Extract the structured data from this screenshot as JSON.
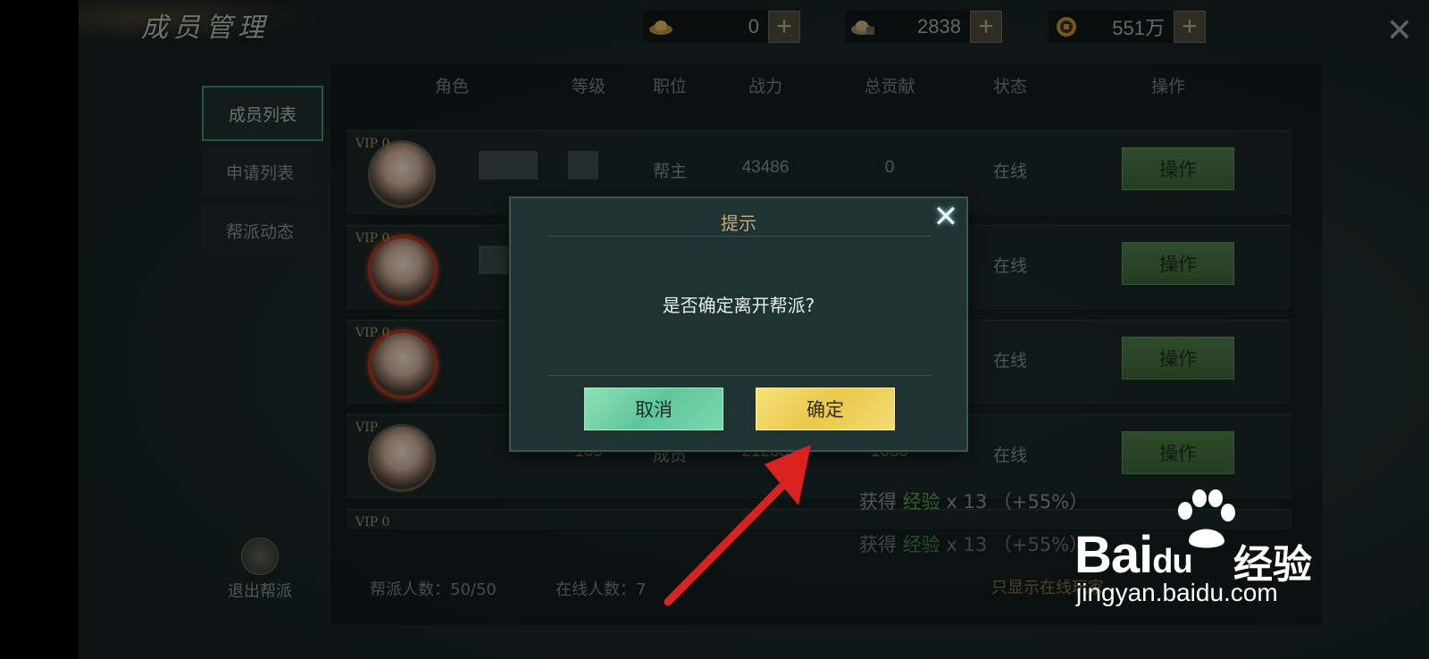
{
  "header": {
    "title": "成员管理",
    "resources": [
      {
        "icon": "gold-ingot-icon",
        "value": "0"
      },
      {
        "icon": "bound-ingot-icon",
        "value": "2838"
      },
      {
        "icon": "coin-icon",
        "value": "551万"
      }
    ],
    "plus_label": "+",
    "close_glyph": "✕"
  },
  "menu": {
    "items": [
      {
        "label": "成员列表",
        "active": true
      },
      {
        "label": "申请列表",
        "active": false
      },
      {
        "label": "帮派动态",
        "active": false
      }
    ],
    "exit_label": "退出帮派"
  },
  "table": {
    "columns": [
      "角色",
      "等级",
      "职位",
      "战力",
      "总贡献",
      "状态",
      "操作"
    ],
    "rows": [
      {
        "vip": "VIP 0",
        "position": "帮主",
        "power": "43486",
        "contribution": "0",
        "status": "在线",
        "action": "操作"
      },
      {
        "vip": "VIP 0",
        "position": "",
        "power": "",
        "contribution": "",
        "status": "在线",
        "action": "操作"
      },
      {
        "vip": "VIP 0",
        "position": "",
        "power": "",
        "contribution": "",
        "status": "在线",
        "action": "操作"
      },
      {
        "vip": "VIP",
        "level": "109",
        "position": "成员",
        "power": "21238",
        "contribution": "1050",
        "status": "在线",
        "action": "操作"
      },
      {
        "vip": "VIP 0"
      }
    ]
  },
  "footer": {
    "member_count": "帮派人数：50/50",
    "online_count": "在线人数：7",
    "only_online": "只显示在线玩家"
  },
  "rewards": [
    {
      "prefix": "获得",
      "item": "经验",
      "suffix": "x 13 （+55%）"
    },
    {
      "prefix": "获得",
      "item": "经验",
      "suffix": "x 13 （+55%）"
    }
  ],
  "dialog": {
    "title": "提示",
    "message": "是否确定离开帮派?",
    "cancel_label": "取消",
    "confirm_label": "确定",
    "close_glyph": "✕"
  },
  "watermark": {
    "brand": "Bai",
    "brand_tail": "du",
    "cn": "经验",
    "url": "jingyan.baidu.com"
  },
  "colors": {
    "accent_gold": "#c7a96a",
    "reward_green": "#4f9c4a",
    "annotation_red": "#d8231f"
  }
}
